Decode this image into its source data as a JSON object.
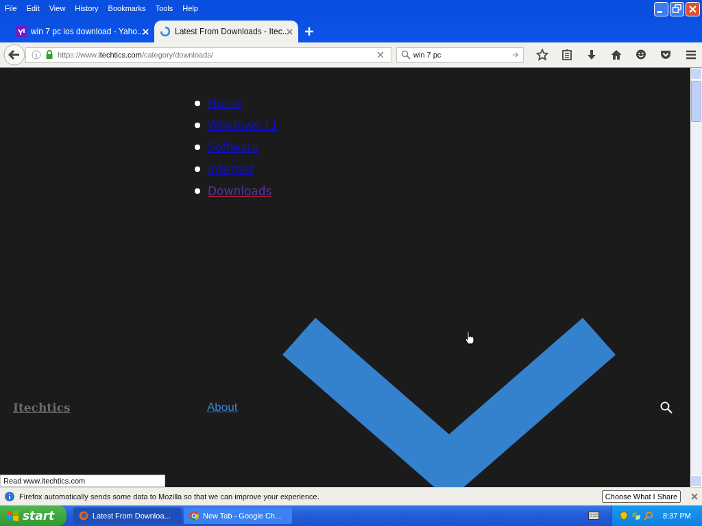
{
  "menu_bar": [
    "File",
    "Edit",
    "View",
    "History",
    "Bookmarks",
    "Tools",
    "Help"
  ],
  "tabs": [
    {
      "title": "win 7 pc ios download - Yaho...",
      "selected": false,
      "kind": "yahoo"
    },
    {
      "title": "Latest From Downloads - Itec...",
      "selected": true,
      "kind": "loading"
    }
  ],
  "address_bar": {
    "scheme": "https://www.",
    "domain": "itechtics.com",
    "path": "/category/downloads/"
  },
  "search": {
    "value": "win 7 pc"
  },
  "page": {
    "nav_links": [
      {
        "label": "Home",
        "selected": false
      },
      {
        "label": "Windows 11",
        "selected": false
      },
      {
        "label": "Software",
        "selected": false
      },
      {
        "label": "Internet",
        "selected": false
      },
      {
        "label": "Downloads",
        "selected": true
      }
    ],
    "brand": "Itechtics",
    "about": "About"
  },
  "status_text": "Read www.itechtics.com",
  "notification": {
    "text": "Firefox automatically sends some data to Mozilla so that we can improve your experience.",
    "button": "Choose What I Share"
  },
  "taskbar": {
    "start": "start",
    "tasks": [
      {
        "title": "Latest From Downloa...",
        "selected": true,
        "kind": "firefox"
      },
      {
        "title": "New Tab - Google Ch...",
        "selected": false,
        "kind": "chrome"
      }
    ],
    "clock": "8:37 PM"
  }
}
